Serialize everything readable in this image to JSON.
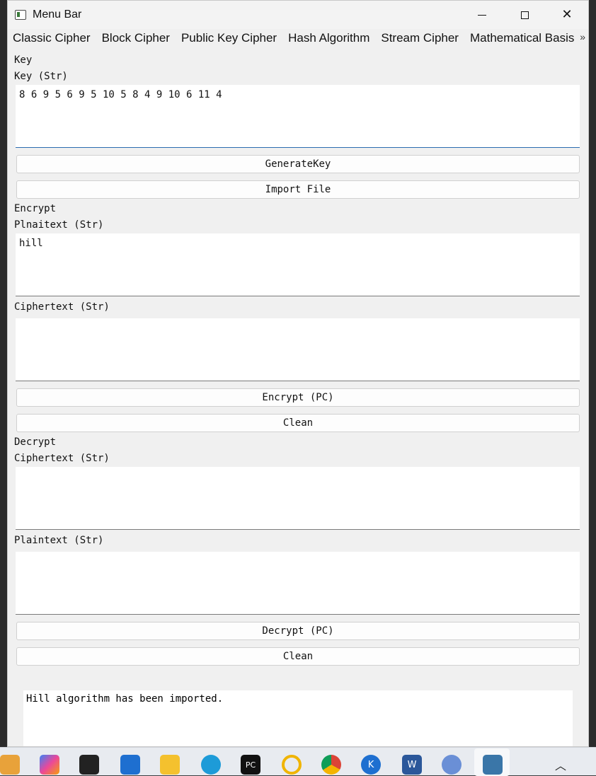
{
  "window": {
    "title": "Menu Bar"
  },
  "menu": {
    "items": [
      "Classic Cipher",
      "Block Cipher",
      "Public Key Cipher",
      "Hash Algorithm",
      "Stream Cipher",
      "Mathematical Basis"
    ],
    "more": "»"
  },
  "key_section": {
    "heading": "Key",
    "field_label": "Key (Str)",
    "value": "8 6 9 5 6 9 5 10 5 8 4 9 10 6 11 4",
    "generate_button": "GenerateKey",
    "import_button": "Import File"
  },
  "encrypt_section": {
    "heading": "Encrypt",
    "plaintext_label": "Plnaitext (Str)",
    "plaintext_value": "hill",
    "ciphertext_label": "Ciphertext (Str)",
    "ciphertext_value": "",
    "encrypt_button": "Encrypt (PC)",
    "clean_button": "Clean"
  },
  "decrypt_section": {
    "heading": "Decrypt",
    "ciphertext_label": "Ciphertext (Str)",
    "ciphertext_value": "",
    "plaintext_label": "Plaintext (Str)",
    "plaintext_value": "",
    "decrypt_button": "Decrypt (PC)",
    "clean_button": "Clean"
  },
  "log": {
    "message": "Hill algorithm has been imported."
  },
  "taskbar": {
    "icons": [
      "charts-icon",
      "copilot-icon",
      "terminal-icon",
      "mail-icon",
      "folder-icon",
      "edge-icon",
      "pycharm-icon",
      "rings-icon",
      "chrome-icon",
      "k-app-icon",
      "word-icon",
      "settings-icon",
      "python-icon"
    ],
    "pycharm_label": "PC",
    "k_label": "K",
    "word_label": "W"
  },
  "colors": {
    "accent": "#2b6cb0",
    "window_bg": "#f0f0f0"
  }
}
